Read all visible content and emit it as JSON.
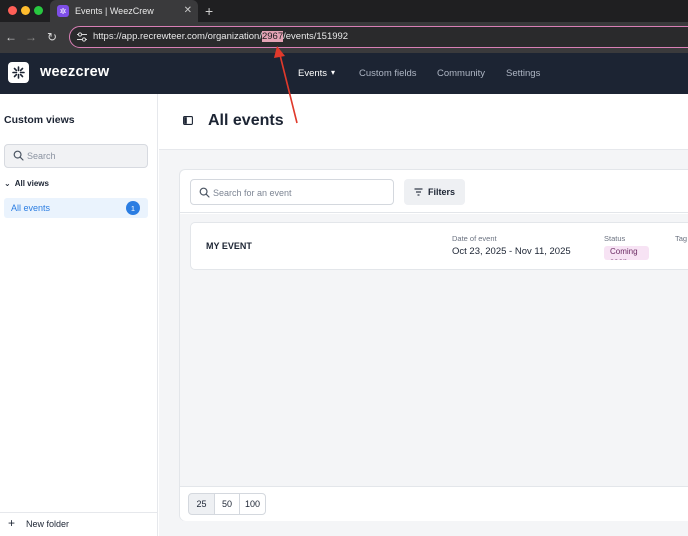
{
  "browser": {
    "tab_title": "Events | WeezCrew",
    "url_prefix": "https://app.recrewteer.com/organization/",
    "url_highlight": "2967",
    "url_suffix": "/events/151992",
    "colors": {
      "url_border": "#d97fb6",
      "highlight": "#e4a3b5",
      "annotation": "#e0392b"
    }
  },
  "app": {
    "brand": "weezcrew",
    "nav": [
      {
        "label": "Events",
        "active": true
      },
      {
        "label": "Custom fields"
      },
      {
        "label": "Community"
      },
      {
        "label": "Settings"
      }
    ]
  },
  "sidebar": {
    "title": "Custom views",
    "search_placeholder": "Search",
    "group_label": "All views",
    "items": [
      {
        "label": "All events",
        "count": "1"
      }
    ],
    "footer_label": "New folder"
  },
  "main": {
    "title": "All events",
    "search_placeholder": "Search for an event",
    "filters_label": "Filters",
    "columns": {
      "date": "Date of event",
      "status": "Status",
      "tag": "Tag"
    },
    "events": [
      {
        "name": "MY EVENT",
        "date": "Oct 23, 2025 - Nov 11, 2025",
        "status": "Coming soon"
      }
    ],
    "page_sizes": [
      "25",
      "50",
      "100"
    ],
    "selected_page_size": "25"
  }
}
